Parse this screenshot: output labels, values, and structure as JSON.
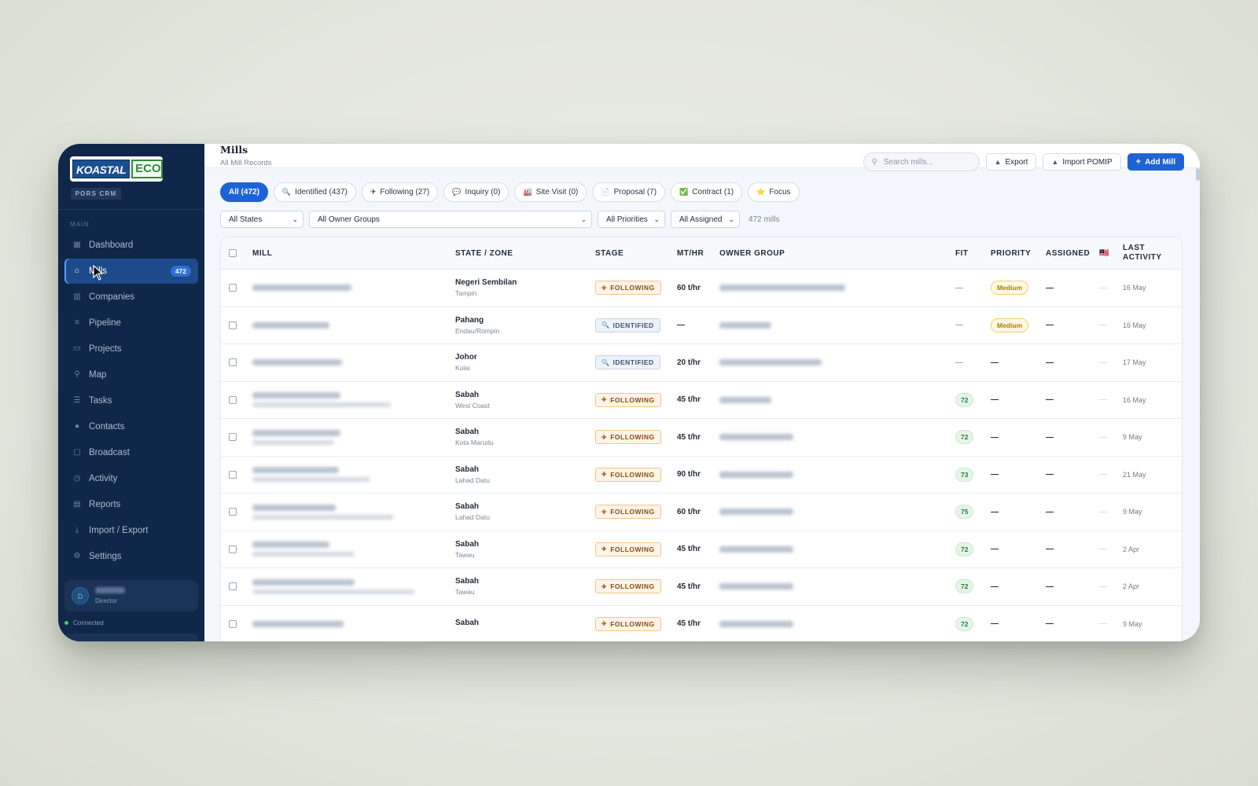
{
  "app": {
    "logo_text_left": "KOASTAL",
    "logo_text_right": "ECO",
    "crm_tag": "PORS CRM"
  },
  "sidebar": {
    "section_label": "MAIN",
    "items": [
      {
        "label": "Dashboard",
        "icon": "grid-icon",
        "glyph": "▦"
      },
      {
        "label": "Mills",
        "icon": "house-icon",
        "glyph": "⌂",
        "badge": "472",
        "active": true
      },
      {
        "label": "Companies",
        "icon": "building-icon",
        "glyph": "▥"
      },
      {
        "label": "Pipeline",
        "icon": "filter-icon",
        "glyph": "≡"
      },
      {
        "label": "Projects",
        "icon": "folder-icon",
        "glyph": "▭"
      },
      {
        "label": "Map",
        "icon": "pin-icon",
        "glyph": "⚲"
      },
      {
        "label": "Tasks",
        "icon": "list-icon",
        "glyph": "☰"
      },
      {
        "label": "Contacts",
        "icon": "person-icon",
        "glyph": "●"
      },
      {
        "label": "Broadcast",
        "icon": "message-icon",
        "glyph": "▢"
      },
      {
        "label": "Activity",
        "icon": "clock-icon",
        "glyph": "◷"
      },
      {
        "label": "Reports",
        "icon": "chart-icon",
        "glyph": "▤"
      },
      {
        "label": "Import / Export",
        "icon": "download-icon",
        "glyph": "⤓"
      },
      {
        "label": "Settings",
        "icon": "gear-icon",
        "glyph": "⚙"
      }
    ],
    "user": {
      "initial": "D",
      "role": "Director"
    },
    "status": "Connected"
  },
  "header": {
    "title": "Mills",
    "subtitle": "All Mill Records",
    "search_placeholder": "Search mills...",
    "export_label": "Export",
    "import_label": "Import POMIP",
    "add_label": "Add Mill"
  },
  "tabs": [
    {
      "label": "All (472)",
      "glyph": "",
      "active": true
    },
    {
      "label": "Identified (437)",
      "glyph": "🔍"
    },
    {
      "label": "Following (27)",
      "glyph": "✈"
    },
    {
      "label": "Inquiry (0)",
      "glyph": "💬"
    },
    {
      "label": "Site Visit (0)",
      "glyph": "🏭"
    },
    {
      "label": "Proposal (7)",
      "glyph": "📄"
    },
    {
      "label": "Contract (1)",
      "glyph": "✅"
    },
    {
      "label": "Focus",
      "glyph": "⭐"
    }
  ],
  "filters": {
    "state": "All States",
    "owner_group": "All Owner Groups",
    "priority": "All Priorities",
    "assigned": "All Assigned",
    "count_text": "472 mills"
  },
  "table": {
    "columns": {
      "mill": "MILL",
      "state": "STATE / ZONE",
      "stage": "STAGE",
      "mthr": "MT/HR",
      "owner": "OWNER GROUP",
      "fit": "FIT",
      "priority": "PRIORITY",
      "assigned": "ASSIGNED",
      "flag": "🇲🇾",
      "last_activity": "LAST ACTIVITY"
    },
    "rows": [
      {
        "state": "Negeri Sembilan",
        "zone": "Tampin",
        "stage": "FOLLOWING",
        "stage_kind": "following",
        "mthr": "60 t/hr",
        "fit": "—",
        "priority": "Medium",
        "assigned": "—",
        "flag": "—",
        "last": "16 May"
      },
      {
        "state": "Pahang",
        "zone": "Endau/Rompin",
        "stage": "IDENTIFIED",
        "stage_kind": "identified",
        "mthr": "—",
        "fit": "—",
        "priority": "Medium",
        "assigned": "—",
        "flag": "—",
        "last": "16 May"
      },
      {
        "state": "Johor",
        "zone": "Kulai",
        "stage": "IDENTIFIED",
        "stage_kind": "identified",
        "mthr": "20 t/hr",
        "fit": "—",
        "priority": "—",
        "assigned": "—",
        "flag": "—",
        "last": "17 May"
      },
      {
        "state": "Sabah",
        "zone": "West Coast",
        "stage": "FOLLOWING",
        "stage_kind": "following",
        "mthr": "45 t/hr",
        "fit": "72",
        "priority": "—",
        "assigned": "—",
        "flag": "—",
        "last": "16 May"
      },
      {
        "state": "Sabah",
        "zone": "Kota Marudu",
        "stage": "FOLLOWING",
        "stage_kind": "following",
        "mthr": "45 t/hr",
        "fit": "72",
        "priority": "—",
        "assigned": "—",
        "flag": "—",
        "last": "9 May"
      },
      {
        "state": "Sabah",
        "zone": "Lahad Datu",
        "stage": "FOLLOWING",
        "stage_kind": "following",
        "mthr": "90 t/hr",
        "fit": "73",
        "priority": "—",
        "assigned": "—",
        "flag": "—",
        "last": "21 May"
      },
      {
        "state": "Sabah",
        "zone": "Lahad Datu",
        "stage": "FOLLOWING",
        "stage_kind": "following",
        "mthr": "60 t/hr",
        "fit": "75",
        "priority": "—",
        "assigned": "—",
        "flag": "—",
        "last": "9 May"
      },
      {
        "state": "Sabah",
        "zone": "Tawau",
        "stage": "FOLLOWING",
        "stage_kind": "following",
        "mthr": "45 t/hr",
        "fit": "72",
        "priority": "—",
        "assigned": "—",
        "flag": "—",
        "last": "2 Apr"
      },
      {
        "state": "Sabah",
        "zone": "Tawau",
        "stage": "FOLLOWING",
        "stage_kind": "following",
        "mthr": "45 t/hr",
        "fit": "72",
        "priority": "—",
        "assigned": "—",
        "flag": "—",
        "last": "2 Apr"
      },
      {
        "state": "Sabah",
        "zone": "",
        "stage": "FOLLOWING",
        "stage_kind": "following",
        "mthr": "45 t/hr",
        "fit": "72",
        "priority": "—",
        "assigned": "—",
        "flag": "—",
        "last": "9 May"
      }
    ]
  },
  "colors": {
    "sidebar_bg": "#0f2748",
    "accent": "#1e63d6",
    "following": "#f2c58a",
    "identified": "#c7d3e2",
    "fit_green": "#2b7a3f",
    "priority_amber": "#b07a00"
  }
}
